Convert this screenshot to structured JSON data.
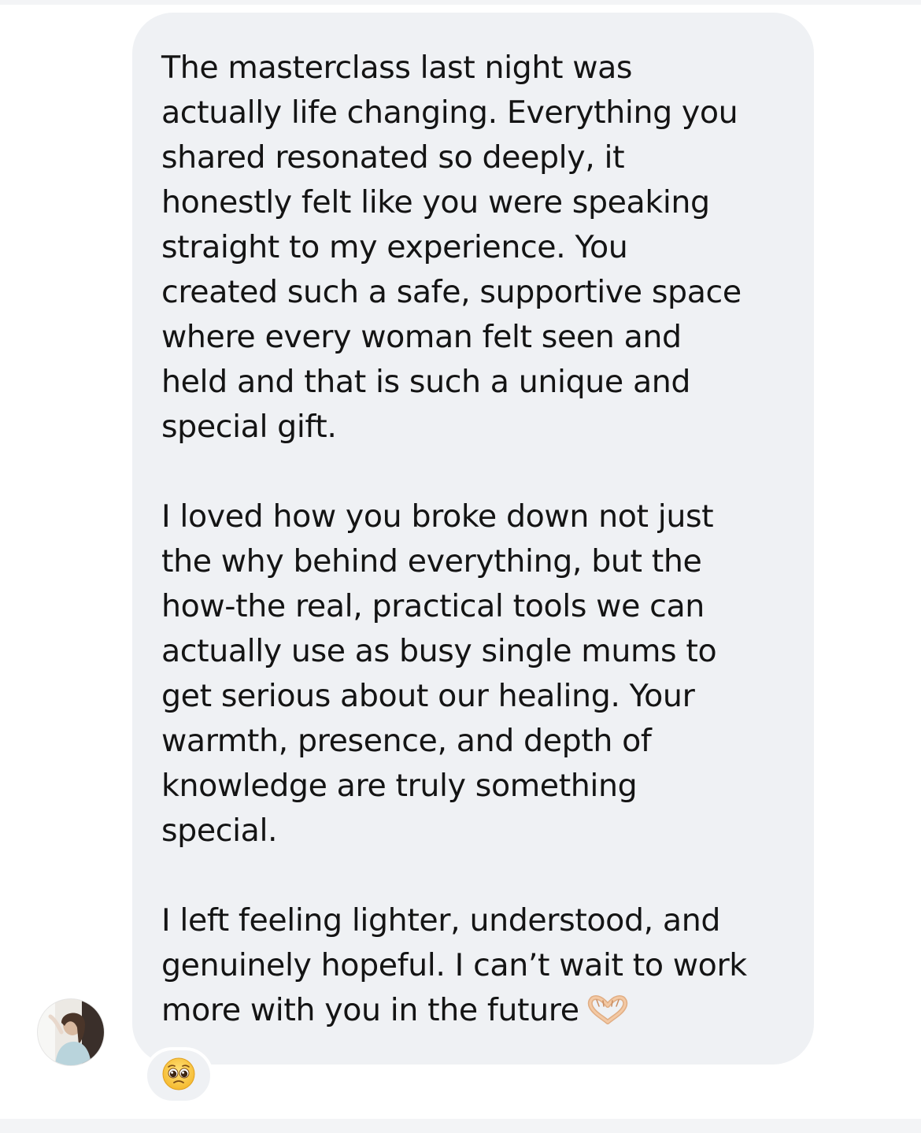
{
  "message": {
    "paragraphs": [
      "The masterclass last night was\nactually life changing. Everything you\nshared resonated so deeply, it\nhonestly felt like you were speaking\nstraight to my experience. You\ncreated such a safe, supportive space\nwhere every woman felt seen and\nheld and that is such a unique and\nspecial gift.",
      "I loved how you broke down not just\nthe why behind everything, but the\nhow-the real, practical tools we can\nactually use as busy single mums to\nget serious about our healing. Your\nwarmth, presence, and depth of\nknowledge are truly something\nspecial.",
      "I left feeling lighter, understood, and\ngenuinely hopeful. I can’t wait to work\nmore with you in the future"
    ],
    "trailing_emoji_icon": "heart-hands-icon",
    "reaction_icon": "pleading-face-icon",
    "sender_avatar": "avatar"
  },
  "colors": {
    "bubble_background": "#eff1f4",
    "text": "#141414",
    "page_background": "#ffffff",
    "strip": "#f3f4f6"
  }
}
